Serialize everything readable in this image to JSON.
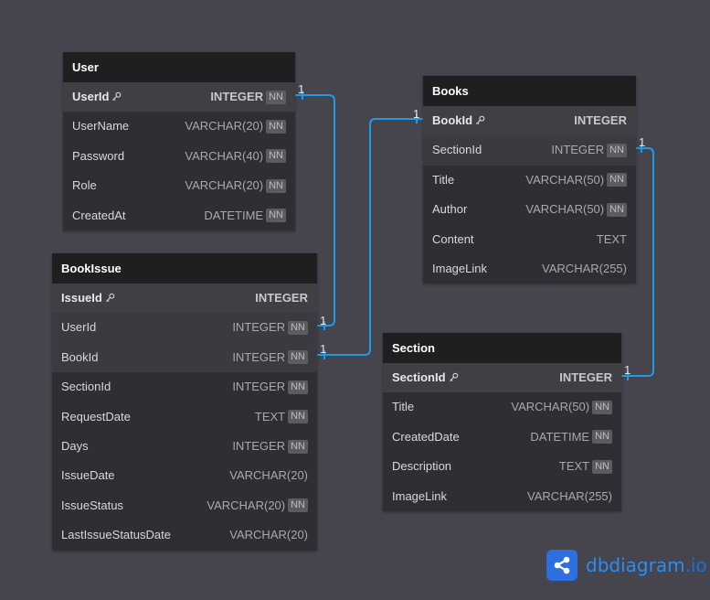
{
  "tables": {
    "user": {
      "title": "User",
      "fields": [
        {
          "name": "UserId",
          "type": "INTEGER",
          "nn": "NN",
          "pk": true
        },
        {
          "name": "UserName",
          "type": "VARCHAR(20)",
          "nn": "NN"
        },
        {
          "name": "Password",
          "type": "VARCHAR(40)",
          "nn": "NN"
        },
        {
          "name": "Role",
          "type": "VARCHAR(20)",
          "nn": "NN"
        },
        {
          "name": "CreatedAt",
          "type": "DATETIME",
          "nn": "NN"
        }
      ]
    },
    "books": {
      "title": "Books",
      "fields": [
        {
          "name": "BookId",
          "type": "INTEGER",
          "nn": "",
          "pk": true
        },
        {
          "name": "SectionId",
          "type": "INTEGER",
          "nn": "NN"
        },
        {
          "name": "Title",
          "type": "VARCHAR(50)",
          "nn": "NN"
        },
        {
          "name": "Author",
          "type": "VARCHAR(50)",
          "nn": "NN"
        },
        {
          "name": "Content",
          "type": "TEXT",
          "nn": ""
        },
        {
          "name": "ImageLink",
          "type": "VARCHAR(255)",
          "nn": ""
        }
      ]
    },
    "bookissue": {
      "title": "BookIssue",
      "fields": [
        {
          "name": "IssueId",
          "type": "INTEGER",
          "nn": "",
          "pk": true
        },
        {
          "name": "UserId",
          "type": "INTEGER",
          "nn": "NN"
        },
        {
          "name": "BookId",
          "type": "INTEGER",
          "nn": "NN"
        },
        {
          "name": "SectionId",
          "type": "INTEGER",
          "nn": "NN"
        },
        {
          "name": "RequestDate",
          "type": "TEXT",
          "nn": "NN"
        },
        {
          "name": "Days",
          "type": "INTEGER",
          "nn": "NN"
        },
        {
          "name": "IssueDate",
          "type": "VARCHAR(20)",
          "nn": ""
        },
        {
          "name": "IssueStatus",
          "type": "VARCHAR(20)",
          "nn": "NN"
        },
        {
          "name": "LastIssueStatusDate",
          "type": "VARCHAR(20)",
          "nn": ""
        }
      ]
    },
    "section": {
      "title": "Section",
      "fields": [
        {
          "name": "SectionId",
          "type": "INTEGER",
          "nn": "",
          "pk": true
        },
        {
          "name": "Title",
          "type": "VARCHAR(50)",
          "nn": "NN"
        },
        {
          "name": "CreatedDate",
          "type": "DATETIME",
          "nn": "NN"
        },
        {
          "name": "Description",
          "type": "TEXT",
          "nn": "NN"
        },
        {
          "name": "ImageLink",
          "type": "VARCHAR(255)",
          "nn": ""
        }
      ]
    }
  },
  "relationships": [
    {
      "from": "BookIssue.UserId",
      "to": "User.UserId",
      "label": "1",
      "label_from": "1"
    },
    {
      "from": "BookIssue.BookId",
      "to": "Books.BookId",
      "label": "1",
      "label_from": "1"
    },
    {
      "from": "Books.SectionId",
      "to": "Section.SectionId",
      "label": "1",
      "label_from": "1"
    }
  ],
  "colors": {
    "background": "#46454e",
    "header": "#1f1f21",
    "body": "#2f2f33",
    "link": "#1e9be6"
  },
  "icons": {
    "key": "key-icon",
    "logo": "share-nodes-icon"
  },
  "logo": {
    "text": "dbdiagram",
    "suffix": ".io"
  }
}
